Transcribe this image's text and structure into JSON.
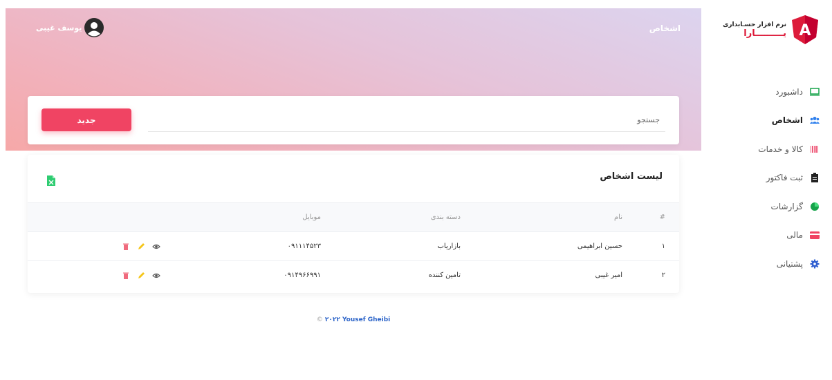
{
  "brand": {
    "line1": "نرم افزار حسـابداری",
    "line2": "یـــــــــارا",
    "logo_letter": "A",
    "color": "#dd1b3a"
  },
  "sidebar": {
    "items": [
      {
        "label": "داشبورد",
        "icon": "laptop-icon",
        "active": false
      },
      {
        "label": "اشخاص",
        "icon": "users-icon",
        "active": true
      },
      {
        "label": "کالا و خدمات",
        "icon": "barcode-icon",
        "active": false
      },
      {
        "label": "ثبت فاکتور",
        "icon": "clipboard-icon",
        "active": false
      },
      {
        "label": "گزارشات",
        "icon": "pie-chart-icon",
        "active": false
      },
      {
        "label": "مالی",
        "icon": "credit-card-icon",
        "active": false
      },
      {
        "label": "پشتیانی",
        "icon": "gear-icon",
        "active": false
      }
    ]
  },
  "header": {
    "title": "اشخاص",
    "user_name": "یوسف غیبی"
  },
  "search": {
    "placeholder": "جستجو",
    "new_label": "جدید"
  },
  "list": {
    "title": "لیست اشخاص",
    "columns": [
      "#",
      "نام",
      "دسته بندی",
      "موبایل",
      ""
    ],
    "rows": [
      {
        "num": "۱",
        "name": "حسین ابراهیمی",
        "category": "بازاریاب",
        "mobile": "۰۹۱۱۱۴۵۲۳"
      },
      {
        "num": "۲",
        "name": "امیر غیبی",
        "category": "تامین کننده",
        "mobile": "۰۹۱۴۹۶۶۹۹۱"
      }
    ]
  },
  "footer": {
    "copyright": "©",
    "author": "Yousef Gheibi",
    "year": "۲۰۲۲"
  },
  "colors": {
    "accent": "#f04463",
    "excel": "#2ecc71",
    "edit": "#f5c518",
    "delete": "#f06b7e"
  }
}
